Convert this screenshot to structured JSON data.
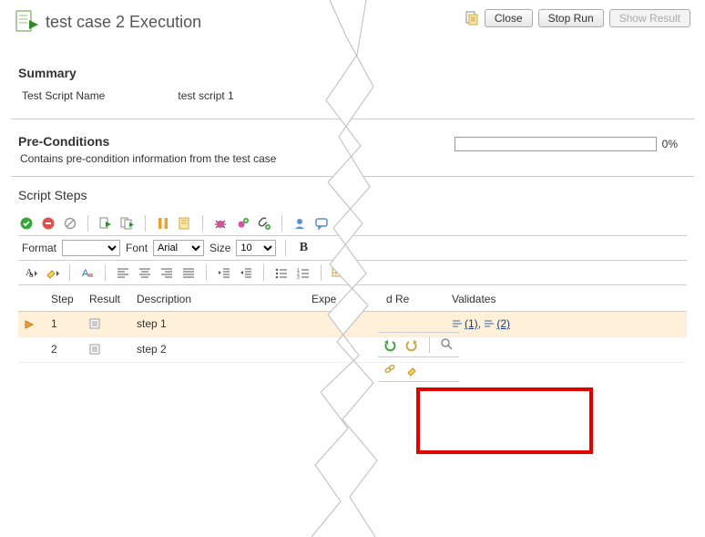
{
  "header": {
    "title": "test case 2 Execution",
    "buttons": {
      "close": "Close",
      "stop_run": "Stop Run",
      "show_result": "Show Result"
    }
  },
  "summary": {
    "heading": "Summary",
    "field_label": "Test Script Name",
    "field_value": "test script 1",
    "progress_pct": "0%"
  },
  "preconditions": {
    "heading": "Pre-Conditions",
    "text": "Contains pre-condition information from the test case"
  },
  "script": {
    "heading": "Script Steps",
    "format_label": "Format",
    "font_label": "Font",
    "font_value": "Arial",
    "size_label": "Size",
    "size_value": "10",
    "columns": {
      "step": "Step",
      "result": "Result",
      "description": "Description",
      "expected_left": "Expe",
      "expected_right": "d Re",
      "validates": "Validates"
    },
    "rows": [
      {
        "num": "1",
        "desc": "step 1",
        "validates_1": "(1)",
        "validates_sep": ", ",
        "validates_2": "(2)"
      },
      {
        "num": "2",
        "desc": "step 2"
      }
    ]
  },
  "icons": {
    "pass": "pass-icon",
    "fail": "fail-icon"
  }
}
